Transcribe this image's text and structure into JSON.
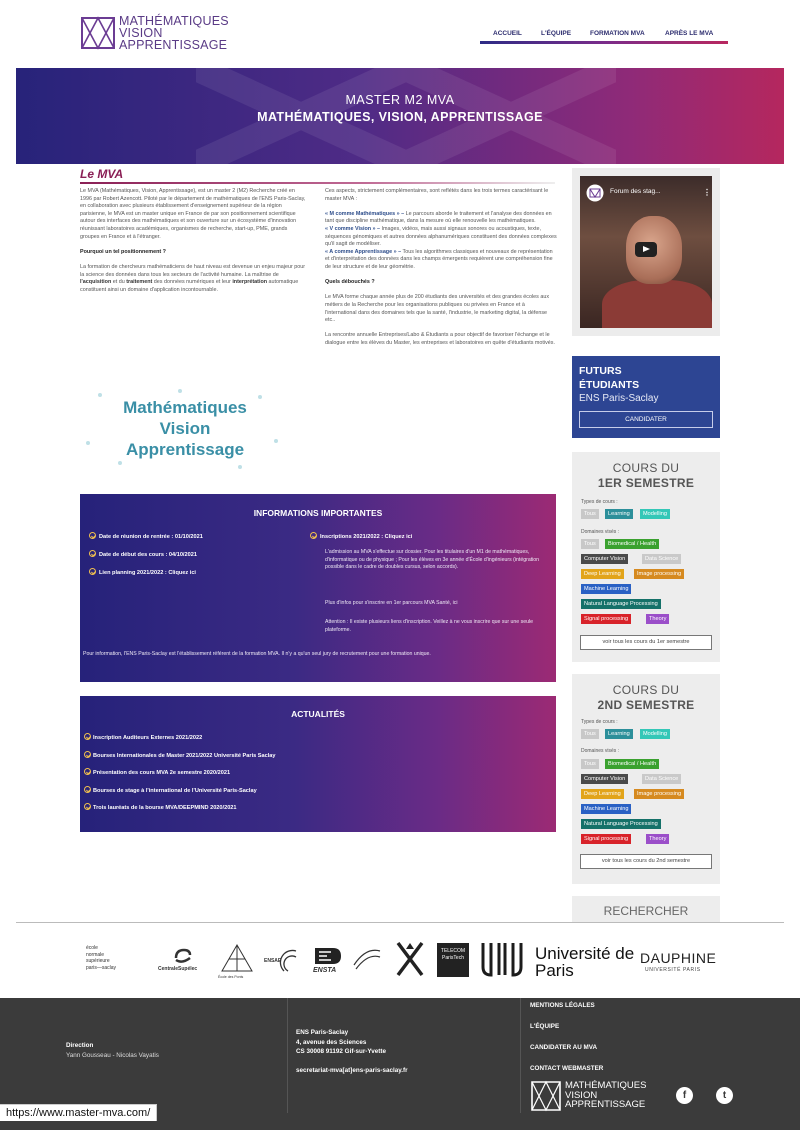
{
  "header": {
    "logo_text": "MATHÉMATIQUES\nVISION\nAPPRENTISSAGE",
    "nav": [
      "ACCUEIL",
      "L'ÉQUIPE",
      "FORMATION MVA",
      "APRÈS LE MVA"
    ]
  },
  "hero": {
    "subtitle": "MASTER M2 MVA",
    "title": "MATHÉMATIQUES, VISION, APPRENTISSAGE"
  },
  "main": {
    "heading": "Le MVA",
    "left_p1": "Le MVA (Mathématiques, Vision, Apprentissage), est un master 2 (M2) Recherche créé en 1996 par Robert Azencott. Piloté par le département de mathématiques de l'ENS Paris-Saclay, en collaboration avec plusieurs établissement d'enseignement supérieur de la région parisienne, le MVA est un master unique en France de par son positionnement scientifique autour des interfaces des mathématiques et son ouverture sur un écosystème d'innovation réunissant laboratoires académiques, organismes de recherche, start-up, PME, grands groupes en France et à l'étranger.",
    "left_q": "Pourquoi un tel positionnement ?",
    "left_p2a": "La formation de chercheurs mathématiciens de haut niveau est devenue un enjeu majeur pour la science des données dans tous les secteurs de l'activité humaine. La maîtrise de ",
    "left_b1": "l'acquisition",
    "left_p2b": " et du ",
    "left_b2": "traitement",
    "left_p2c": " des données numériques et leur ",
    "left_b3": "interprétation",
    "left_p2d": " automatique constituent ainsi un domaine d'application incontournable.",
    "image_text": [
      "Mathématiques",
      "Vision",
      "Apprentissage"
    ],
    "right_p1": "Ces aspects, strictement complémentaires, sont reflétés dans les trois termes caractérisant le master MVA :",
    "right_m_label": "« M comme Mathématiques » –",
    "right_m": " Le parcours aborde le traitement et l'analyse des données en tant que discipline mathématique, dans la mesure où elle renouvelle les mathématiques.",
    "right_v_label": "« V comme Vision » –",
    "right_v": " Images, vidéos, mais aussi signaux sonores ou acoustiques, texte, séquences génomiques et autres données alphanumériques constituent des données complexes qu'il sagit de modéliser.",
    "right_a_label": "« A comme Apprentissage » –",
    "right_a": " Tous les algorithmes classiques et nouveaux de représentation et d'interprétation des données dans les champs émergents requièrent une compréhension fine de leur structure et de leur géométrie.",
    "right_q": "Quels débouchés ?",
    "right_p2": "Le MVA forme chaque année plus de 200 étudiants des universités et des grandes écoles aux métiers de la Recherche pour les organisations publiques ou privées en France et à l'international dans des domaines tels que la santé, l'industrie, le marketing digital, la défense etc..",
    "right_p3": "La rencontre annuelle Entreprises/Labo & Étudiants a pour objectif de favoriser l'échange et le dialogue entre les élèves du Master, les entreprises et laboratoires en quête d'étudiants motivés."
  },
  "info": {
    "title": "INFORMATIONS IMPORTANTES",
    "items_left": [
      "Date de réunion de rentrée : 01/10/2021",
      "Date de début des cours : 04/10/2021",
      "Lien planning 2021/2022 : Cliquez ici"
    ],
    "item_right": "Inscriptions 2021/2022 : Cliquez ici",
    "p1": "L'admission au MVA s'effectue sur dossier. Pour les titulaires d'un M1 de mathématiques, d'informatique ou de physique ; Pour les élèves en 3e année d'École d'ingénieurs (intégration possible dans le cadre de doubles cursus, selon accords).",
    "p2": "Plus d'infos pour s'inscrire en 1er parcours MVA Santé, ici",
    "p3": "Attention : Il existe plusieurs liens d'inscription. Veillez à ne vous inscrire que sur une seule plateforme.",
    "footnote": "Pour information, l'ENS Paris-Saclay est l'établissement référent de la formation MVA. Il n'y a qu'un seul jury de recrutement pour une formation unique."
  },
  "news": {
    "title": "ACTUALITÉS",
    "items": [
      "Inscription Auditeurs Externes 2021/2022",
      "Bourses Internationales de Master 2021/2022 Université Paris Saclay",
      "Présentation des cours MVA 2e semestre 2020/2021",
      "Bourses de stage à l'international de l'Université Paris-Saclay",
      "Trois lauréats de la bourse MVA/DEEPMIND 2020/2021"
    ]
  },
  "sidebar": {
    "video_title": "Forum des stag...",
    "futurs_a": "FUTURS",
    "futurs_b": "ÉTUDIANTS",
    "futurs_c": "ENS Paris-Saclay",
    "candidater": "CANDIDATER",
    "s1_h1": "COURS DU",
    "s1_h2": "1ER SEMESTRE",
    "s2_h1": "COURS DU",
    "s2_h2": "2ND SEMESTRE",
    "types_label": "Types de cours :",
    "domaines_label": "Domaines visés :",
    "types": [
      "Tous",
      "Learning",
      "Modelling"
    ],
    "domaines": [
      "Tous",
      "Biomedical / Health",
      "Computer Vision",
      "Data Science",
      "Deep Learning",
      "Image processing",
      "Machine Learning",
      "Natural Language Processing",
      "Signal processing",
      "Theory"
    ],
    "s1_btn": "voir tous les cours du 1er semestre",
    "s2_btn": "voir tous les cours du 2nd semestre",
    "rechercher": "RECHERCHER",
    "colors": {
      "tous": "#c8c8c8",
      "learning": "#2c8f9a",
      "modelling": "#34c7b7",
      "bio": "#3aa12f",
      "cv": "#4a4a4a",
      "ds": "#c9c9c9",
      "deep": "#e2a41a",
      "img": "#d68a20",
      "ml": "#2a61c4",
      "nlp": "#157169",
      "sig": "#d8232a",
      "theory": "#9b4fc9"
    }
  },
  "partners": {
    "ens": [
      "école",
      "normale",
      "supérieure",
      "paris—saclay"
    ],
    "centrale": "CentraleSupélec",
    "ponts": "École des Ponts",
    "ensae": "ENSAE",
    "ensta": "ENSTA",
    "telecom": "TELECOM ParisTech",
    "upc": "Université de Paris",
    "dauphine": "DAUPHINE",
    "dauphine_sub": "UNIVERSITÉ PARIS"
  },
  "footer": {
    "direction_label": "Direction",
    "direction": "Yann Gousseau - Nicolas Vayatis",
    "addr1": "ENS Paris-Saclay",
    "addr2": "4, avenue des Sciences",
    "addr3": "CS 30008 91192 Gif-sur-Yvette",
    "email": "secretariat-mva[at]ens-paris-saclay.fr",
    "links": [
      "MENTIONS LÉGALES",
      "L'ÉQUIPE",
      "CANDIDATER AU MVA",
      "CONTACT WEBMASTER"
    ],
    "logo_text": "MATHÉMATIQUES\nVISION\nAPPRENTISSAGE",
    "fb": "f",
    "tw": "t"
  },
  "url": "https://www.master-mva.com/"
}
